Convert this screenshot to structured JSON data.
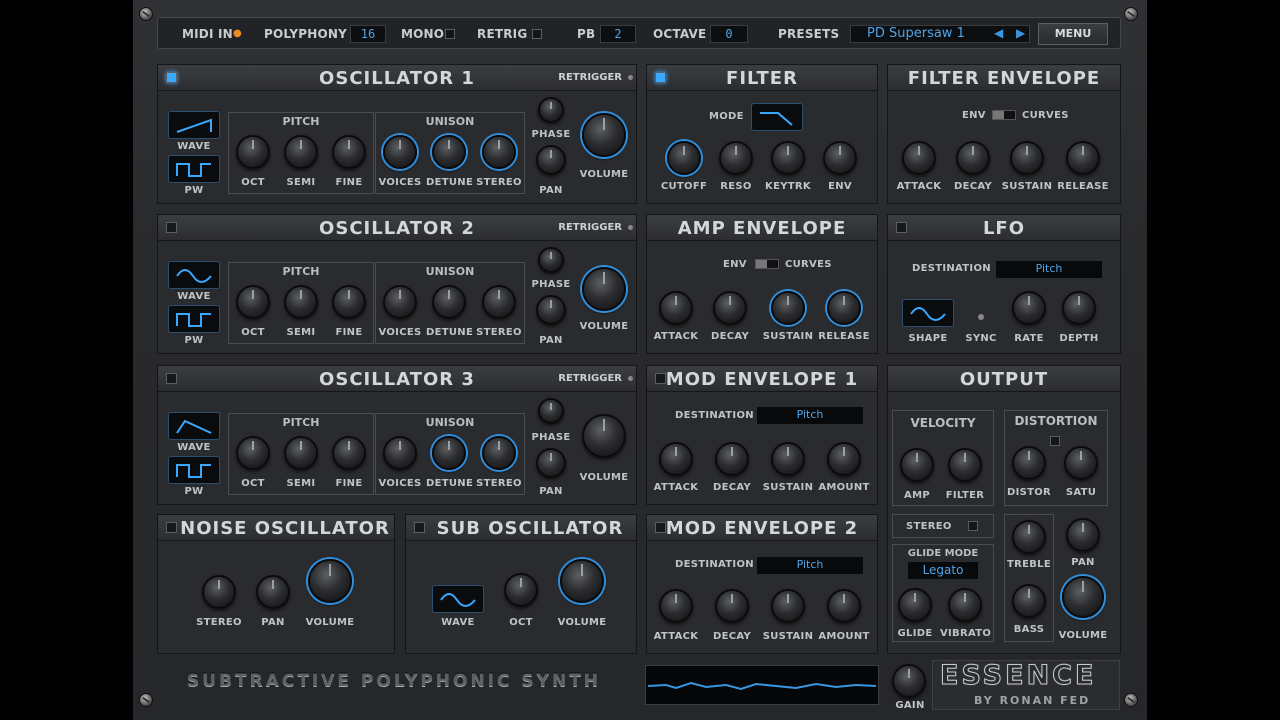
{
  "topbar": {
    "midi_in": "MIDI IN",
    "polyphony_label": "POLYPHONY",
    "polyphony_value": "16",
    "mono_label": "MONO",
    "retrig_label": "RETRIG",
    "pb_label": "PB",
    "pb_value": "2",
    "octave_label": "OCTAVE",
    "octave_value": "0",
    "presets_label": "PRESETS",
    "preset_name": "PD Supersaw 1",
    "prev_arrow": "◀",
    "next_arrow": "▶",
    "menu_label": "MENU"
  },
  "common": {
    "retrigger": "RETRIGGER",
    "pitch": "PITCH",
    "unison": "UNISON",
    "wave": "WAVE",
    "pw": "PW",
    "oct": "OCT",
    "semi": "SEMI",
    "fine": "FINE",
    "voices": "VOICES",
    "detune": "DETUNE",
    "stereo": "STEREO",
    "phase": "PHASE",
    "pan": "PAN",
    "volume": "VOLUME",
    "attack": "ATTACK",
    "decay": "DECAY",
    "sustain": "SUSTAIN",
    "release": "RELEASE",
    "amount": "AMOUNT",
    "destination": "DESTINATION",
    "env": "ENV",
    "curves": "CURVES"
  },
  "osc1": {
    "title": "OSCILLATOR 1"
  },
  "osc2": {
    "title": "OSCILLATOR 2"
  },
  "osc3": {
    "title": "OSCILLATOR 3"
  },
  "filter": {
    "title": "FILTER",
    "mode": "MODE",
    "cutoff": "CUTOFF",
    "reso": "RESO",
    "keytrk": "KEYTRK",
    "env": "ENV"
  },
  "filter_env": {
    "title": "FILTER ENVELOPE"
  },
  "amp_env": {
    "title": "AMP ENVELOPE"
  },
  "lfo": {
    "title": "LFO",
    "destination_value": "Pitch",
    "shape": "SHAPE",
    "sync": "SYNC",
    "rate": "RATE",
    "depth": "DEPTH"
  },
  "mod_env1": {
    "title": "MOD ENVELOPE 1",
    "destination_value": "Pitch"
  },
  "mod_env2": {
    "title": "MOD ENVELOPE 2",
    "destination_value": "Pitch"
  },
  "noise": {
    "title": "NOISE OSCILLATOR"
  },
  "sub": {
    "title": "SUB OSCILLATOR"
  },
  "output": {
    "title": "OUTPUT",
    "velocity": "VELOCITY",
    "amp": "AMP",
    "filter": "FILTER",
    "distortion": "DISTORTION",
    "distor": "DISTOR",
    "satu": "SATU",
    "stereo": "STEREO",
    "glide_mode": "GLIDE MODE",
    "glide_mode_value": "Legato",
    "glide": "GLIDE",
    "vibrato": "VIBRATO",
    "treble": "TREBLE",
    "bass": "BASS",
    "pan": "PAN",
    "volume": "VOLUME"
  },
  "footer": {
    "subtitle": "SUBTRACTIVE POLYPHONIC SYNTH",
    "gain": "GAIN",
    "logo": "ESSENCE",
    "logo_sub": "BY RONAN FED"
  },
  "colors": {
    "accent": "#3aa8ff",
    "display_text": "#4ea4ea",
    "panel": "#2a2b2e"
  }
}
